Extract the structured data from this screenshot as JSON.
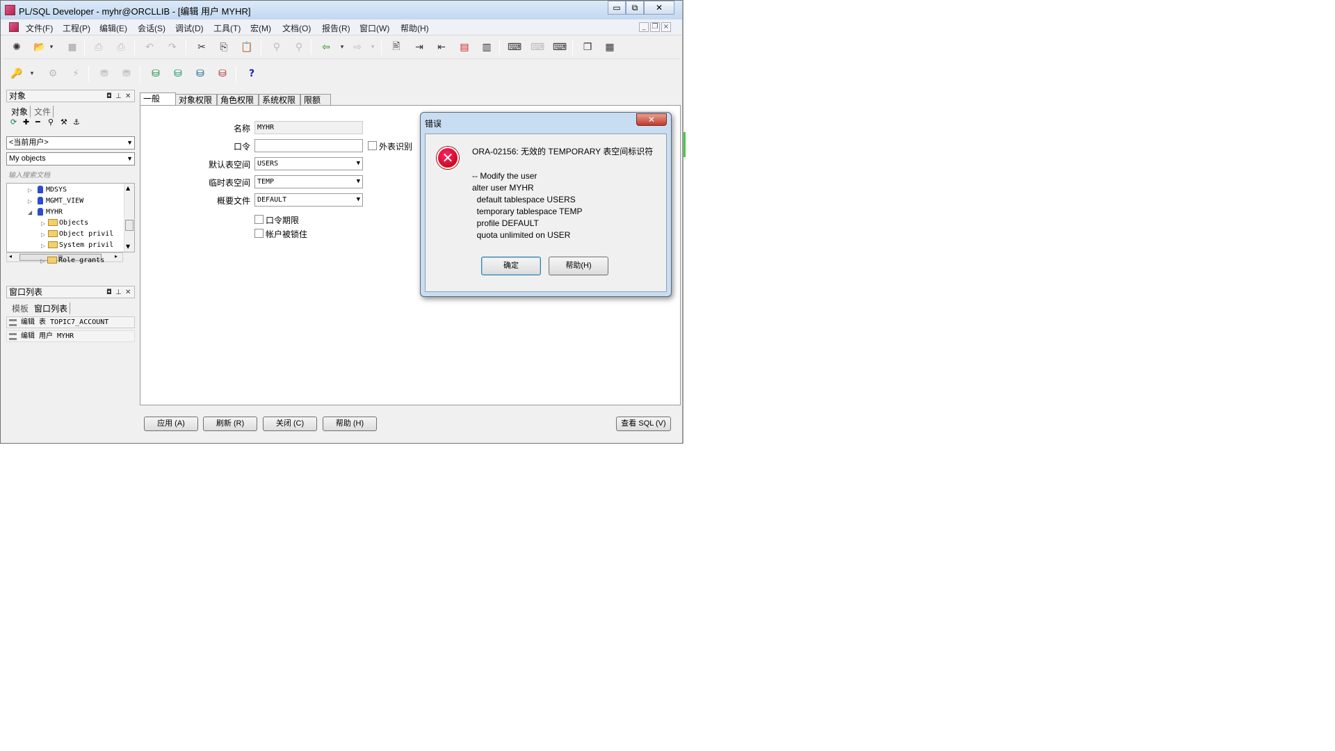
{
  "window": {
    "title": "PL/SQL Developer - myhr@ORCLLIB - [编辑 用户 MYHR]",
    "min": "▭",
    "max": "⧉",
    "close": "✕"
  },
  "menu": [
    "文件(F)",
    "工程(P)",
    "编辑(E)",
    "会话(S)",
    "调试(D)",
    "工具(T)",
    "宏(M)",
    "文档(O)",
    "报告(R)",
    "窗口(W)",
    "帮助(H)"
  ],
  "object_panel": {
    "title": "对象",
    "tabs": [
      "对象",
      "文件"
    ],
    "user_combo": "<当前用户>",
    "filter_combo": "My objects",
    "search_placeholder": "输入搜索文档",
    "tree": [
      {
        "label": "MDSYS",
        "level": 1,
        "kind": "user",
        "state": "collapsed"
      },
      {
        "label": "MGMT_VIEW",
        "level": 1,
        "kind": "user",
        "state": "collapsed"
      },
      {
        "label": "MYHR",
        "level": 1,
        "kind": "user",
        "state": "expanded"
      },
      {
        "label": "Objects",
        "level": 2,
        "kind": "folder",
        "state": "collapsed"
      },
      {
        "label": "Object privil",
        "level": 2,
        "kind": "folder",
        "state": "collapsed"
      },
      {
        "label": "System privil",
        "level": 2,
        "kind": "folder",
        "state": "collapsed"
      },
      {
        "label": "Role grants",
        "level": 2,
        "kind": "folder",
        "state": "collapsed"
      }
    ],
    "hscroll_label": "III"
  },
  "window_list": {
    "title": "窗口列表",
    "tabs": [
      "模板",
      "窗口列表"
    ],
    "items": [
      "编辑 表 TOPIC7_ACCOUNT",
      "编辑 用户 MYHR"
    ]
  },
  "editor": {
    "tabs": [
      "一般",
      "对象权限",
      "角色权限",
      "系统权限",
      "限额"
    ],
    "fields": {
      "name_label": "名称",
      "name_value": "MYHR",
      "password_label": "口令",
      "password_value": "",
      "external_label": "外表识别",
      "default_ts_label": "默认表空间",
      "default_ts_value": "USERS",
      "temp_ts_label": "临时表空间",
      "temp_ts_value": "TEMP",
      "profile_label": "概要文件",
      "profile_value": "DEFAULT",
      "pwd_expire_label": "口令期限",
      "locked_label": "帐户被锁住"
    },
    "buttons": {
      "apply": "应用 (A)",
      "refresh": "刷新 (R)",
      "close": "关闭 (C)",
      "help": "帮助 (H)",
      "view_sql": "查看 SQL (V)"
    }
  },
  "dialog": {
    "title": "错误",
    "close": "✕",
    "message_line1": "ORA-02156: 无效的 TEMPORARY 表空间标识符",
    "sql_lines": [
      "-- Modify the user",
      "alter user MYHR",
      "  default tablespace USERS",
      "  temporary tablespace TEMP",
      "  profile DEFAULT",
      "  quota unlimited on USER"
    ],
    "ok": "确定",
    "help": "帮助(H)"
  }
}
